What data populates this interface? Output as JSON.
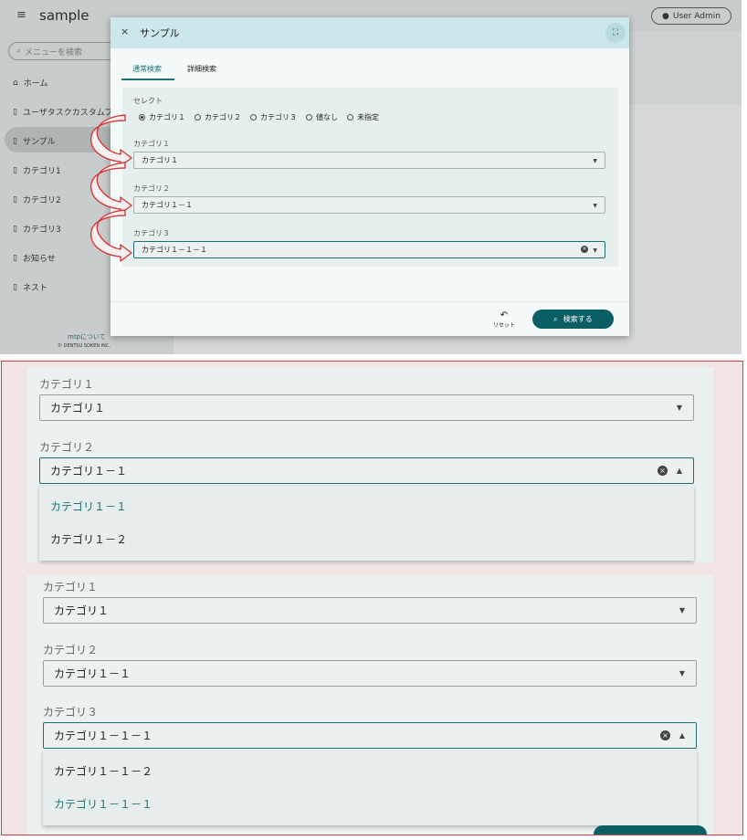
{
  "app": {
    "title": "sample",
    "user_button": "User Admin"
  },
  "sidebar": {
    "search_placeholder": "メニューを検索",
    "items": [
      {
        "label": "ホーム",
        "icon": "home-icon"
      },
      {
        "label": "ユーザタスクカスタムプロパ",
        "icon": "page-icon"
      },
      {
        "label": "サンプル",
        "icon": "page-icon",
        "active": true
      },
      {
        "label": "カテゴリ1",
        "icon": "page-icon"
      },
      {
        "label": "カテゴリ2",
        "icon": "page-icon"
      },
      {
        "label": "カテゴリ3",
        "icon": "page-icon"
      },
      {
        "label": "お知らせ",
        "icon": "page-icon"
      },
      {
        "label": "ネスト",
        "icon": "page-icon"
      }
    ],
    "footer_link": "mtpについて",
    "copyright": "© DENTSU SOKEN INC."
  },
  "modal": {
    "title": "サンプル",
    "tabs": [
      {
        "label": "通常検索",
        "active": true
      },
      {
        "label": "詳細検索",
        "active": false
      }
    ],
    "select_label": "セレクト",
    "radio_options": [
      {
        "label": "カテゴリ１",
        "checked": true
      },
      {
        "label": "カテゴリ２",
        "checked": false
      },
      {
        "label": "カテゴリ３",
        "checked": false
      },
      {
        "label": "値なし",
        "checked": false
      },
      {
        "label": "未指定",
        "checked": false
      }
    ],
    "fields": [
      {
        "label": "カテゴリ１",
        "value": "カテゴリ１"
      },
      {
        "label": "カテゴリ２",
        "value": "カテゴリ１－１"
      },
      {
        "label": "カテゴリ３",
        "value": "カテゴリ１－１－１"
      }
    ],
    "reset_label": "リセット",
    "search_label": "検索する"
  },
  "detail_top": {
    "fields": [
      {
        "label": "カテゴリ１",
        "value": "カテゴリ１"
      },
      {
        "label": "カテゴリ２",
        "value": "カテゴリ１－１"
      }
    ],
    "options": [
      {
        "label": "カテゴリ１－１",
        "selected": true
      },
      {
        "label": "カテゴリ１－２",
        "selected": false
      }
    ]
  },
  "detail_bottom": {
    "fields": [
      {
        "label": "カテゴリ１",
        "value": "カテゴリ１"
      },
      {
        "label": "カテゴリ２",
        "value": "カテゴリ１－１"
      },
      {
        "label": "カテゴリ３",
        "value": "カテゴリ１－１－１"
      }
    ],
    "options": [
      {
        "label": "カテゴリ１－１－２",
        "selected": false
      },
      {
        "label": "カテゴリ１－１－１",
        "selected": true
      }
    ]
  },
  "colors": {
    "accent": "#0b5e64",
    "header_tint": "#cce7ea",
    "annotation_arrow": "#d43a3a"
  }
}
